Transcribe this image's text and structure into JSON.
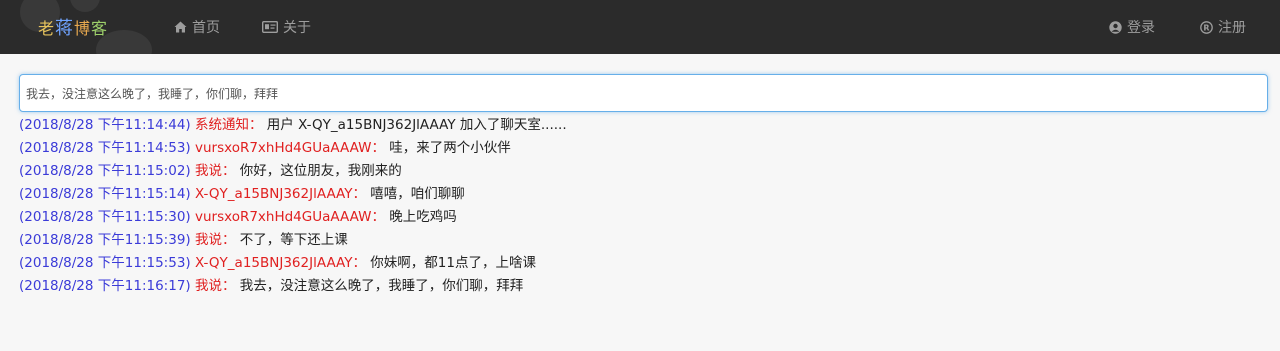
{
  "navbar": {
    "brand": [
      "老",
      "蒋",
      "博",
      "客"
    ],
    "links": [
      {
        "label": "首页",
        "icon": "home-icon"
      },
      {
        "label": "关于",
        "icon": "id-card-icon"
      }
    ],
    "auth": [
      {
        "label": "登录",
        "icon": "user-circle-icon"
      },
      {
        "label": "注册",
        "icon": "registered-icon"
      }
    ],
    "colors": {
      "background": "#2b2b2b",
      "link": "#9d9d9d"
    }
  },
  "chat": {
    "input_value": "我去，没注意这么晚了，我睡了，你们聊，拜拜",
    "messages": [
      {
        "time": "(2018/8/28 下午11:14:44)",
        "name": "系统通知：",
        "text": "用户 X-QY_a15BNJ362JlAAAY 加入了聊天室......"
      },
      {
        "time": "(2018/8/28 下午11:14:53)",
        "name": "vursxoR7xhHd4GUaAAAW：",
        "text": "哇，来了两个小伙伴"
      },
      {
        "time": "(2018/8/28 下午11:15:02)",
        "name": "我说：",
        "text": "你好，这位朋友，我刚来的"
      },
      {
        "time": "(2018/8/28 下午11:15:14)",
        "name": "X-QY_a15BNJ362JlAAAY：",
        "text": "嘻嘻，咱们聊聊"
      },
      {
        "time": "(2018/8/28 下午11:15:30)",
        "name": "vursxoR7xhHd4GUaAAAW：",
        "text": "晚上吃鸡吗"
      },
      {
        "time": "(2018/8/28 下午11:15:39)",
        "name": "我说：",
        "text": "不了，等下还上课"
      },
      {
        "time": "(2018/8/28 下午11:15:53)",
        "name": "X-QY_a15BNJ362JlAAAY：",
        "text": "你妹啊，都11点了，上啥课"
      },
      {
        "time": "(2018/8/28 下午11:16:17)",
        "name": "我说：",
        "text": "我去，没注意这么晚了，我睡了，你们聊，拜拜"
      }
    ],
    "colors": {
      "timestamp": "#3b3bd8",
      "name": "#e02020",
      "text": "#222222",
      "input_border": "#66afe9"
    }
  }
}
